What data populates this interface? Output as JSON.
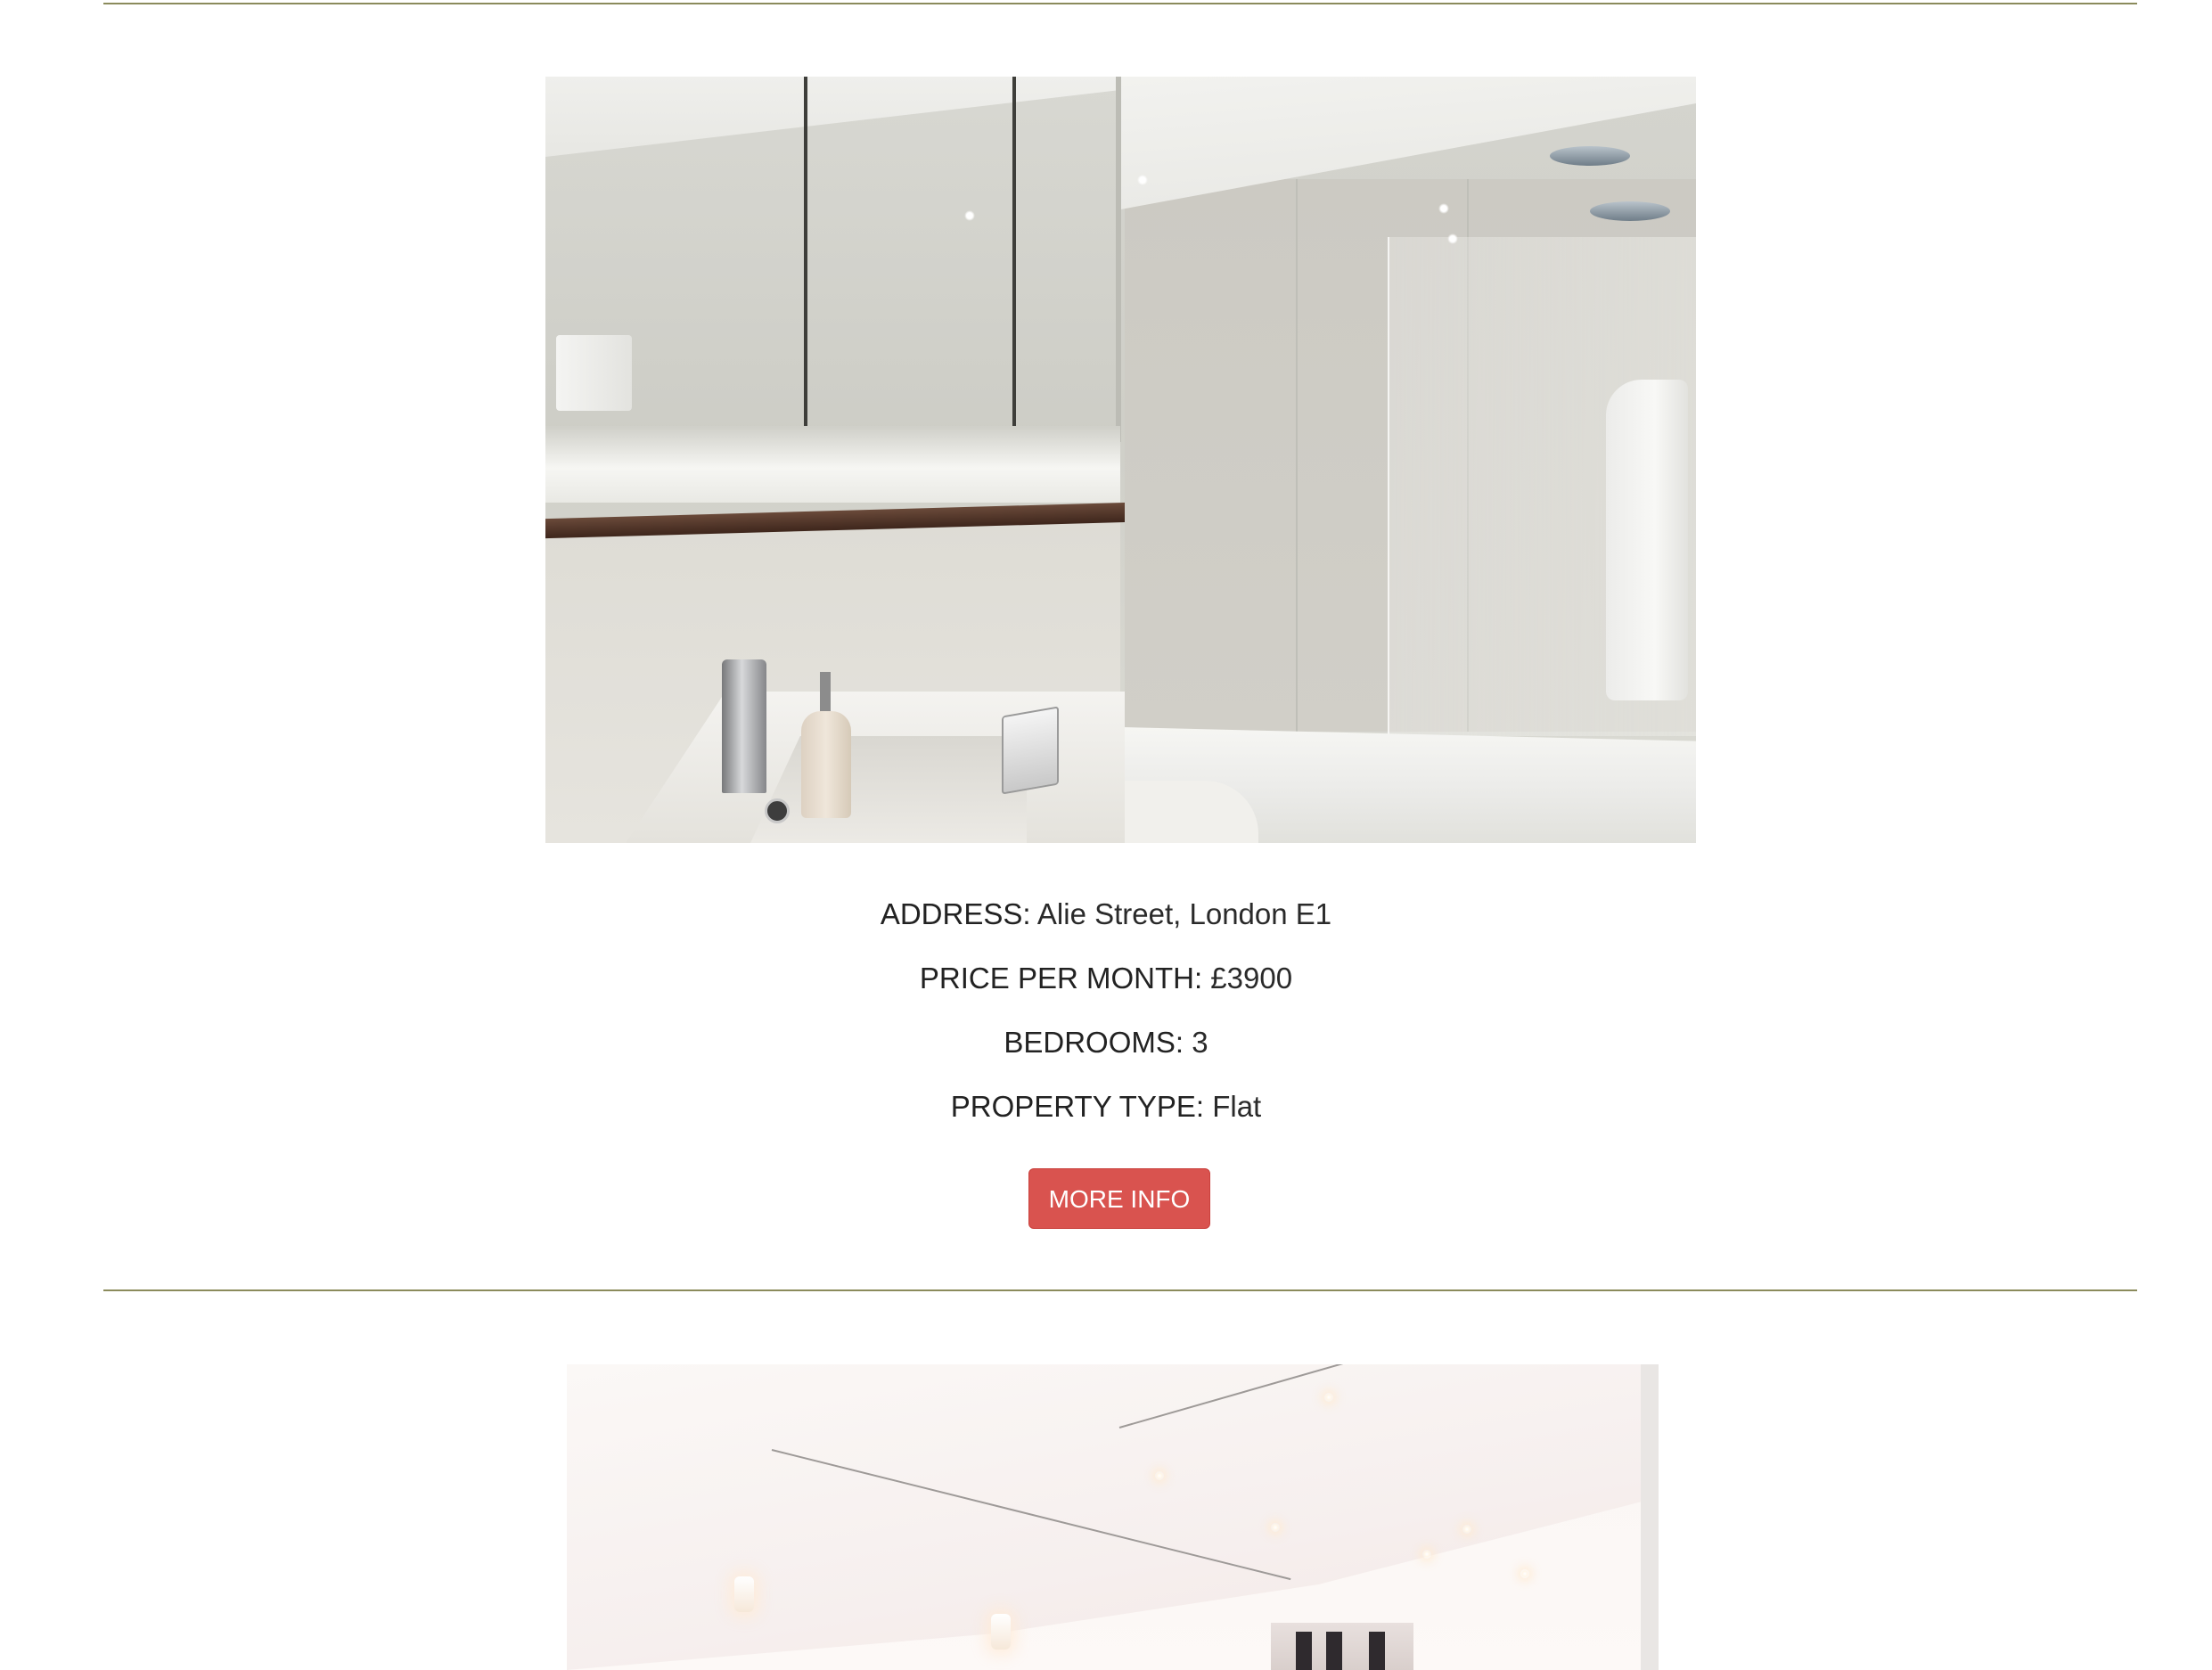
{
  "listings": [
    {
      "photo_alt": "Bathroom",
      "address_label": "ADDRESS:",
      "address_value": "Alie Street, London E1",
      "price_label": "PRICE PER MONTH:",
      "price_value": "£3900",
      "bedrooms_label": "BEDROOMS:",
      "bedrooms_value": "3",
      "type_label": "PROPERTY TYPE:",
      "type_value": "Flat",
      "button_label": "MORE INFO"
    },
    {
      "photo_alt": "Living room"
    }
  ],
  "colors": {
    "divider": "#8b8b5c",
    "button_bg": "#d9534f",
    "button_text": "#ffffff",
    "text": "#222222"
  }
}
